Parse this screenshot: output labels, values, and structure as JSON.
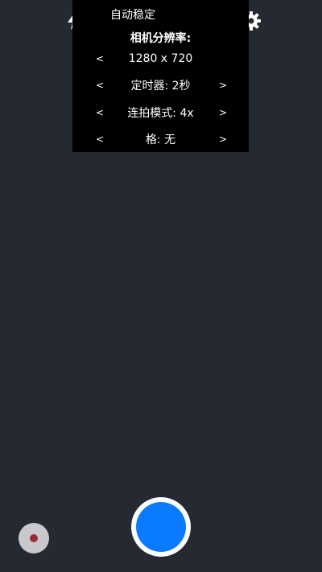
{
  "menu": {
    "stabilization_label": "自动稳定",
    "resolution_header": "相机分辨率:",
    "resolution_value": "1280 x 720",
    "timer_label": "定时器: 2秒",
    "burst_label": "连拍模式: 4x",
    "grid_label": "格: 无",
    "prev_arrow": "<",
    "next_arrow": ">"
  },
  "icons": {
    "flash": "flash-auto-icon",
    "hdr": "hdr-icon",
    "focus": "focus-icon",
    "settings": "gear-icon"
  },
  "colors": {
    "viewfinder_bg": "#252a32",
    "menu_bg": "#000000",
    "shutter": "#0a7bff",
    "record_dot": "#9b2b3a"
  }
}
